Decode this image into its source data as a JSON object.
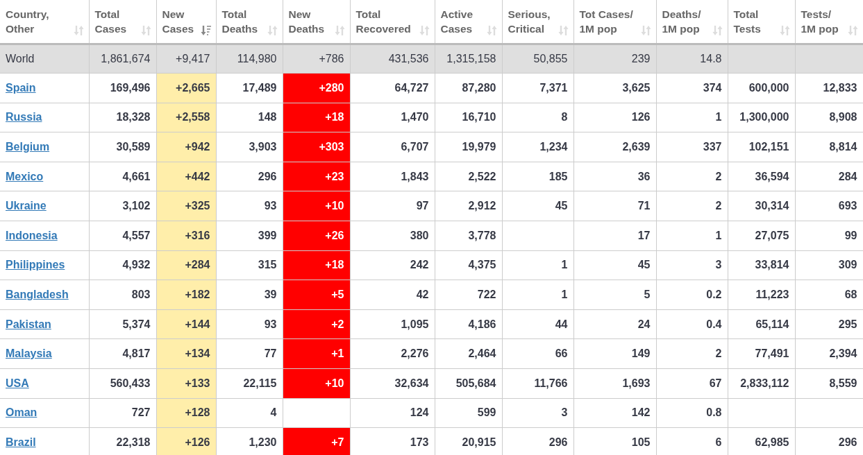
{
  "table": {
    "columns": [
      {
        "label_lines": [
          "Country,",
          "Other"
        ],
        "kind": "country",
        "sorted": false
      },
      {
        "label_lines": [
          "Total",
          "Cases"
        ],
        "kind": "plain",
        "sorted": false
      },
      {
        "label_lines": [
          "New",
          "Cases"
        ],
        "kind": "new_cases",
        "sorted": true
      },
      {
        "label_lines": [
          "Total",
          "Deaths"
        ],
        "kind": "plain",
        "sorted": false
      },
      {
        "label_lines": [
          "New",
          "Deaths"
        ],
        "kind": "new_deaths",
        "sorted": false
      },
      {
        "label_lines": [
          "Total",
          "Recovered"
        ],
        "kind": "plain",
        "sorted": false
      },
      {
        "label_lines": [
          "Active",
          "Cases"
        ],
        "kind": "plain",
        "sorted": false
      },
      {
        "label_lines": [
          "Serious,",
          "Critical"
        ],
        "kind": "plain",
        "sorted": false
      },
      {
        "label_lines": [
          "Tot Cases/",
          "1M pop"
        ],
        "kind": "plain",
        "sorted": false
      },
      {
        "label_lines": [
          "Deaths/",
          "1M pop"
        ],
        "kind": "plain",
        "sorted": false
      },
      {
        "label_lines": [
          "Total",
          "Tests"
        ],
        "kind": "plain",
        "sorted": false
      },
      {
        "label_lines": [
          "Tests/",
          "1M pop"
        ],
        "kind": "plain",
        "sorted": false
      }
    ],
    "rows": [
      {
        "kind": "total",
        "cells": [
          "World",
          "1,861,674",
          "+9,417",
          "114,980",
          "+786",
          "431,536",
          "1,315,158",
          "50,855",
          "239",
          "14.8",
          "",
          ""
        ]
      },
      {
        "kind": "country",
        "cells": [
          "Spain",
          "169,496",
          "+2,665",
          "17,489",
          "+280",
          "64,727",
          "87,280",
          "7,371",
          "3,625",
          "374",
          "600,000",
          "12,833"
        ]
      },
      {
        "kind": "country",
        "cells": [
          "Russia",
          "18,328",
          "+2,558",
          "148",
          "+18",
          "1,470",
          "16,710",
          "8",
          "126",
          "1",
          "1,300,000",
          "8,908"
        ]
      },
      {
        "kind": "country",
        "cells": [
          "Belgium",
          "30,589",
          "+942",
          "3,903",
          "+303",
          "6,707",
          "19,979",
          "1,234",
          "2,639",
          "337",
          "102,151",
          "8,814"
        ]
      },
      {
        "kind": "country",
        "cells": [
          "Mexico",
          "4,661",
          "+442",
          "296",
          "+23",
          "1,843",
          "2,522",
          "185",
          "36",
          "2",
          "36,594",
          "284"
        ]
      },
      {
        "kind": "country",
        "cells": [
          "Ukraine",
          "3,102",
          "+325",
          "93",
          "+10",
          "97",
          "2,912",
          "45",
          "71",
          "2",
          "30,314",
          "693"
        ]
      },
      {
        "kind": "country",
        "cells": [
          "Indonesia",
          "4,557",
          "+316",
          "399",
          "+26",
          "380",
          "3,778",
          "",
          "17",
          "1",
          "27,075",
          "99"
        ]
      },
      {
        "kind": "country",
        "cells": [
          "Philippines",
          "4,932",
          "+284",
          "315",
          "+18",
          "242",
          "4,375",
          "1",
          "45",
          "3",
          "33,814",
          "309"
        ]
      },
      {
        "kind": "country",
        "cells": [
          "Bangladesh",
          "803",
          "+182",
          "39",
          "+5",
          "42",
          "722",
          "1",
          "5",
          "0.2",
          "11,223",
          "68"
        ]
      },
      {
        "kind": "country",
        "cells": [
          "Pakistan",
          "5,374",
          "+144",
          "93",
          "+2",
          "1,095",
          "4,186",
          "44",
          "24",
          "0.4",
          "65,114",
          "295"
        ]
      },
      {
        "kind": "country",
        "cells": [
          "Malaysia",
          "4,817",
          "+134",
          "77",
          "+1",
          "2,276",
          "2,464",
          "66",
          "149",
          "2",
          "77,491",
          "2,394"
        ]
      },
      {
        "kind": "country",
        "cells": [
          "USA",
          "560,433",
          "+133",
          "22,115",
          "+10",
          "32,634",
          "505,684",
          "11,766",
          "1,693",
          "67",
          "2,833,112",
          "8,559"
        ]
      },
      {
        "kind": "country",
        "cells": [
          "Oman",
          "727",
          "+128",
          "4",
          "",
          "124",
          "599",
          "3",
          "142",
          "0.8",
          "",
          ""
        ]
      },
      {
        "kind": "country",
        "cells": [
          "Brazil",
          "22,318",
          "+126",
          "1,230",
          "+7",
          "173",
          "20,915",
          "296",
          "105",
          "6",
          "62,985",
          "296"
        ]
      }
    ]
  }
}
